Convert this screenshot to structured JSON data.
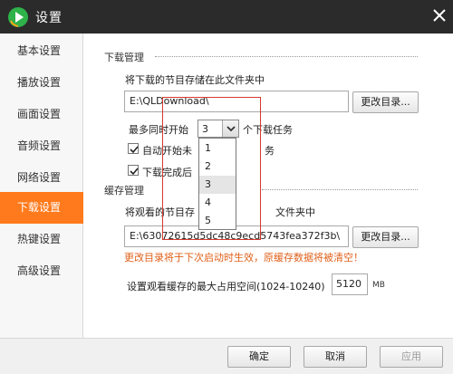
{
  "window": {
    "title": "设置"
  },
  "sidebar": {
    "items": [
      {
        "label": "基本设置",
        "active": false
      },
      {
        "label": "播放设置",
        "active": false
      },
      {
        "label": "画面设置",
        "active": false
      },
      {
        "label": "音频设置",
        "active": false
      },
      {
        "label": "网络设置",
        "active": false
      },
      {
        "label": "下载设置",
        "active": true
      },
      {
        "label": "热键设置",
        "active": false
      },
      {
        "label": "高级设置",
        "active": false
      }
    ],
    "active_color": "#ff7a1c"
  },
  "download": {
    "section_title": "下载管理",
    "folder_label": "将下载的节目存储在此文件夹中",
    "folder_path": "E:\\QLDownload\\",
    "change_dir_button": "更改目录...",
    "max_tasks_prefix": "最多同时开始",
    "max_tasks_value": "3",
    "max_tasks_suffix": "个下载任务",
    "max_tasks_options": [
      "1",
      "2",
      "3",
      "4",
      "5"
    ],
    "auto_start_label_visible": "自动开始未",
    "auto_start_label_tail": "务",
    "auto_start_checked": true,
    "on_complete_label_visible": "下载完成后",
    "on_complete_checked": true
  },
  "cache": {
    "section_title": "缓存管理",
    "folder_label_visible": "将观看的节目存",
    "folder_label_tail": "文件夹中",
    "folder_path": "E:\\63072615d5dc48c9ecd5743fea372f3b\\",
    "change_dir_button": "更改目录...",
    "warning": "更改目录将于下次启动时生效，原缓存数据将被清空！",
    "warning_color": "#e0601a",
    "max_space_label": "设置观看缓存的最大占用空间(1024-10240)",
    "max_space_value": "5120",
    "max_space_unit": "MB"
  },
  "footer": {
    "ok_button": "确定",
    "cancel_button": "取消",
    "apply_button": "应用"
  },
  "icons": {
    "app_logo": "play-logo-icon",
    "close": "close-icon",
    "dropdown_arrow": "chevron-down-icon",
    "check": "checkmark-icon"
  }
}
